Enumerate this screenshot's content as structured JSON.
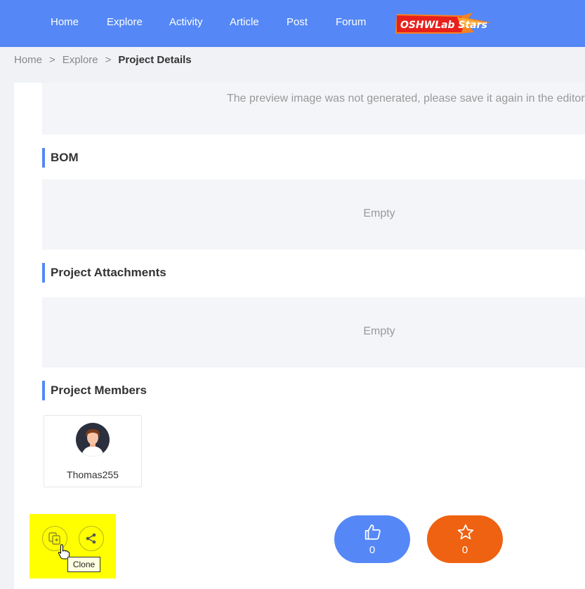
{
  "nav": {
    "items": [
      "Home",
      "Explore",
      "Activity",
      "Article",
      "Post",
      "Forum"
    ],
    "logo_text": "OSHWLab Stars"
  },
  "breadcrumb": {
    "items": [
      "Home",
      "Explore"
    ],
    "separator": ">",
    "current": "Project Details"
  },
  "preview": {
    "message": "The preview image was not generated, please save it again in the editor."
  },
  "bom": {
    "title": "BOM",
    "empty_text": "Empty"
  },
  "attachments": {
    "title": "Project Attachments",
    "empty_text": "Empty"
  },
  "members": {
    "title": "Project Members",
    "list": [
      {
        "name": "Thomas255",
        "avatar_icon": "avatar-icon"
      }
    ]
  },
  "toolbar": {
    "clone_icon": "clone-icon",
    "share_icon": "share-icon",
    "tooltip": "Clone"
  },
  "actions": {
    "like_icon": "thumbs-up-icon",
    "like_count": "0",
    "favorite_icon": "star-icon",
    "favorite_count": "0"
  },
  "colors": {
    "nav_bg": "#5588f6",
    "accent": "#5588f6",
    "favorite": "#ee6211",
    "highlight": "#ffff00",
    "page_bg": "#f0f2f5"
  }
}
